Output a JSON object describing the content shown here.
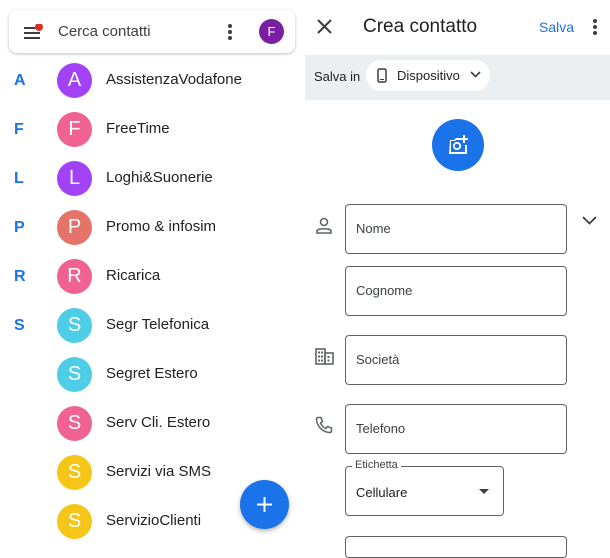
{
  "contacts_list": {
    "search_placeholder": "Cerca contatti",
    "account_initial": "F",
    "index_letters": [
      "A",
      "F",
      "L",
      "P",
      "R",
      "S"
    ],
    "items": [
      {
        "initial": "A",
        "name": "AssistenzaVodafone",
        "color": "#a142f4"
      },
      {
        "initial": "F",
        "name": "FreeTime",
        "color": "#f06292"
      },
      {
        "initial": "L",
        "name": "Loghi&Suonerie",
        "color": "#a142f4"
      },
      {
        "initial": "P",
        "name": "Promo & infosim",
        "color": "#e57368"
      },
      {
        "initial": "R",
        "name": "Ricarica",
        "color": "#f06292"
      },
      {
        "initial": "S",
        "name": "Segr Telefonica",
        "color": "#4ecde6"
      },
      {
        "initial": "S",
        "name": "Segret Estero",
        "color": "#4ecde6"
      },
      {
        "initial": "S",
        "name": "Serv Cli. Estero",
        "color": "#f06292"
      },
      {
        "initial": "S",
        "name": "Servizi via SMS",
        "color": "#f5c518"
      },
      {
        "initial": "S",
        "name": "ServizioClienti",
        "color": "#f5c518"
      }
    ]
  },
  "create_contact": {
    "title": "Crea contatto",
    "save_label": "Salva",
    "save_in_label": "Salva in",
    "save_in_value": "Dispositivo",
    "fields": {
      "first_name": "Nome",
      "last_name": "Cognome",
      "company": "Società",
      "phone": "Telefono"
    },
    "phone_label_legend": "Etichetta",
    "phone_label_value": "Cellulare"
  },
  "colors": {
    "accent": "#1a73e8",
    "avatar_account": "#7b1fa2",
    "notification_dot": "#d93025",
    "save_in_bar": "#eceff1"
  },
  "icons": [
    "menu-icon",
    "more-vert-icon",
    "close-icon",
    "phone-device-icon",
    "chevron-down-icon",
    "add-photo-icon",
    "person-icon",
    "business-icon",
    "phone-icon",
    "plus-icon"
  ]
}
